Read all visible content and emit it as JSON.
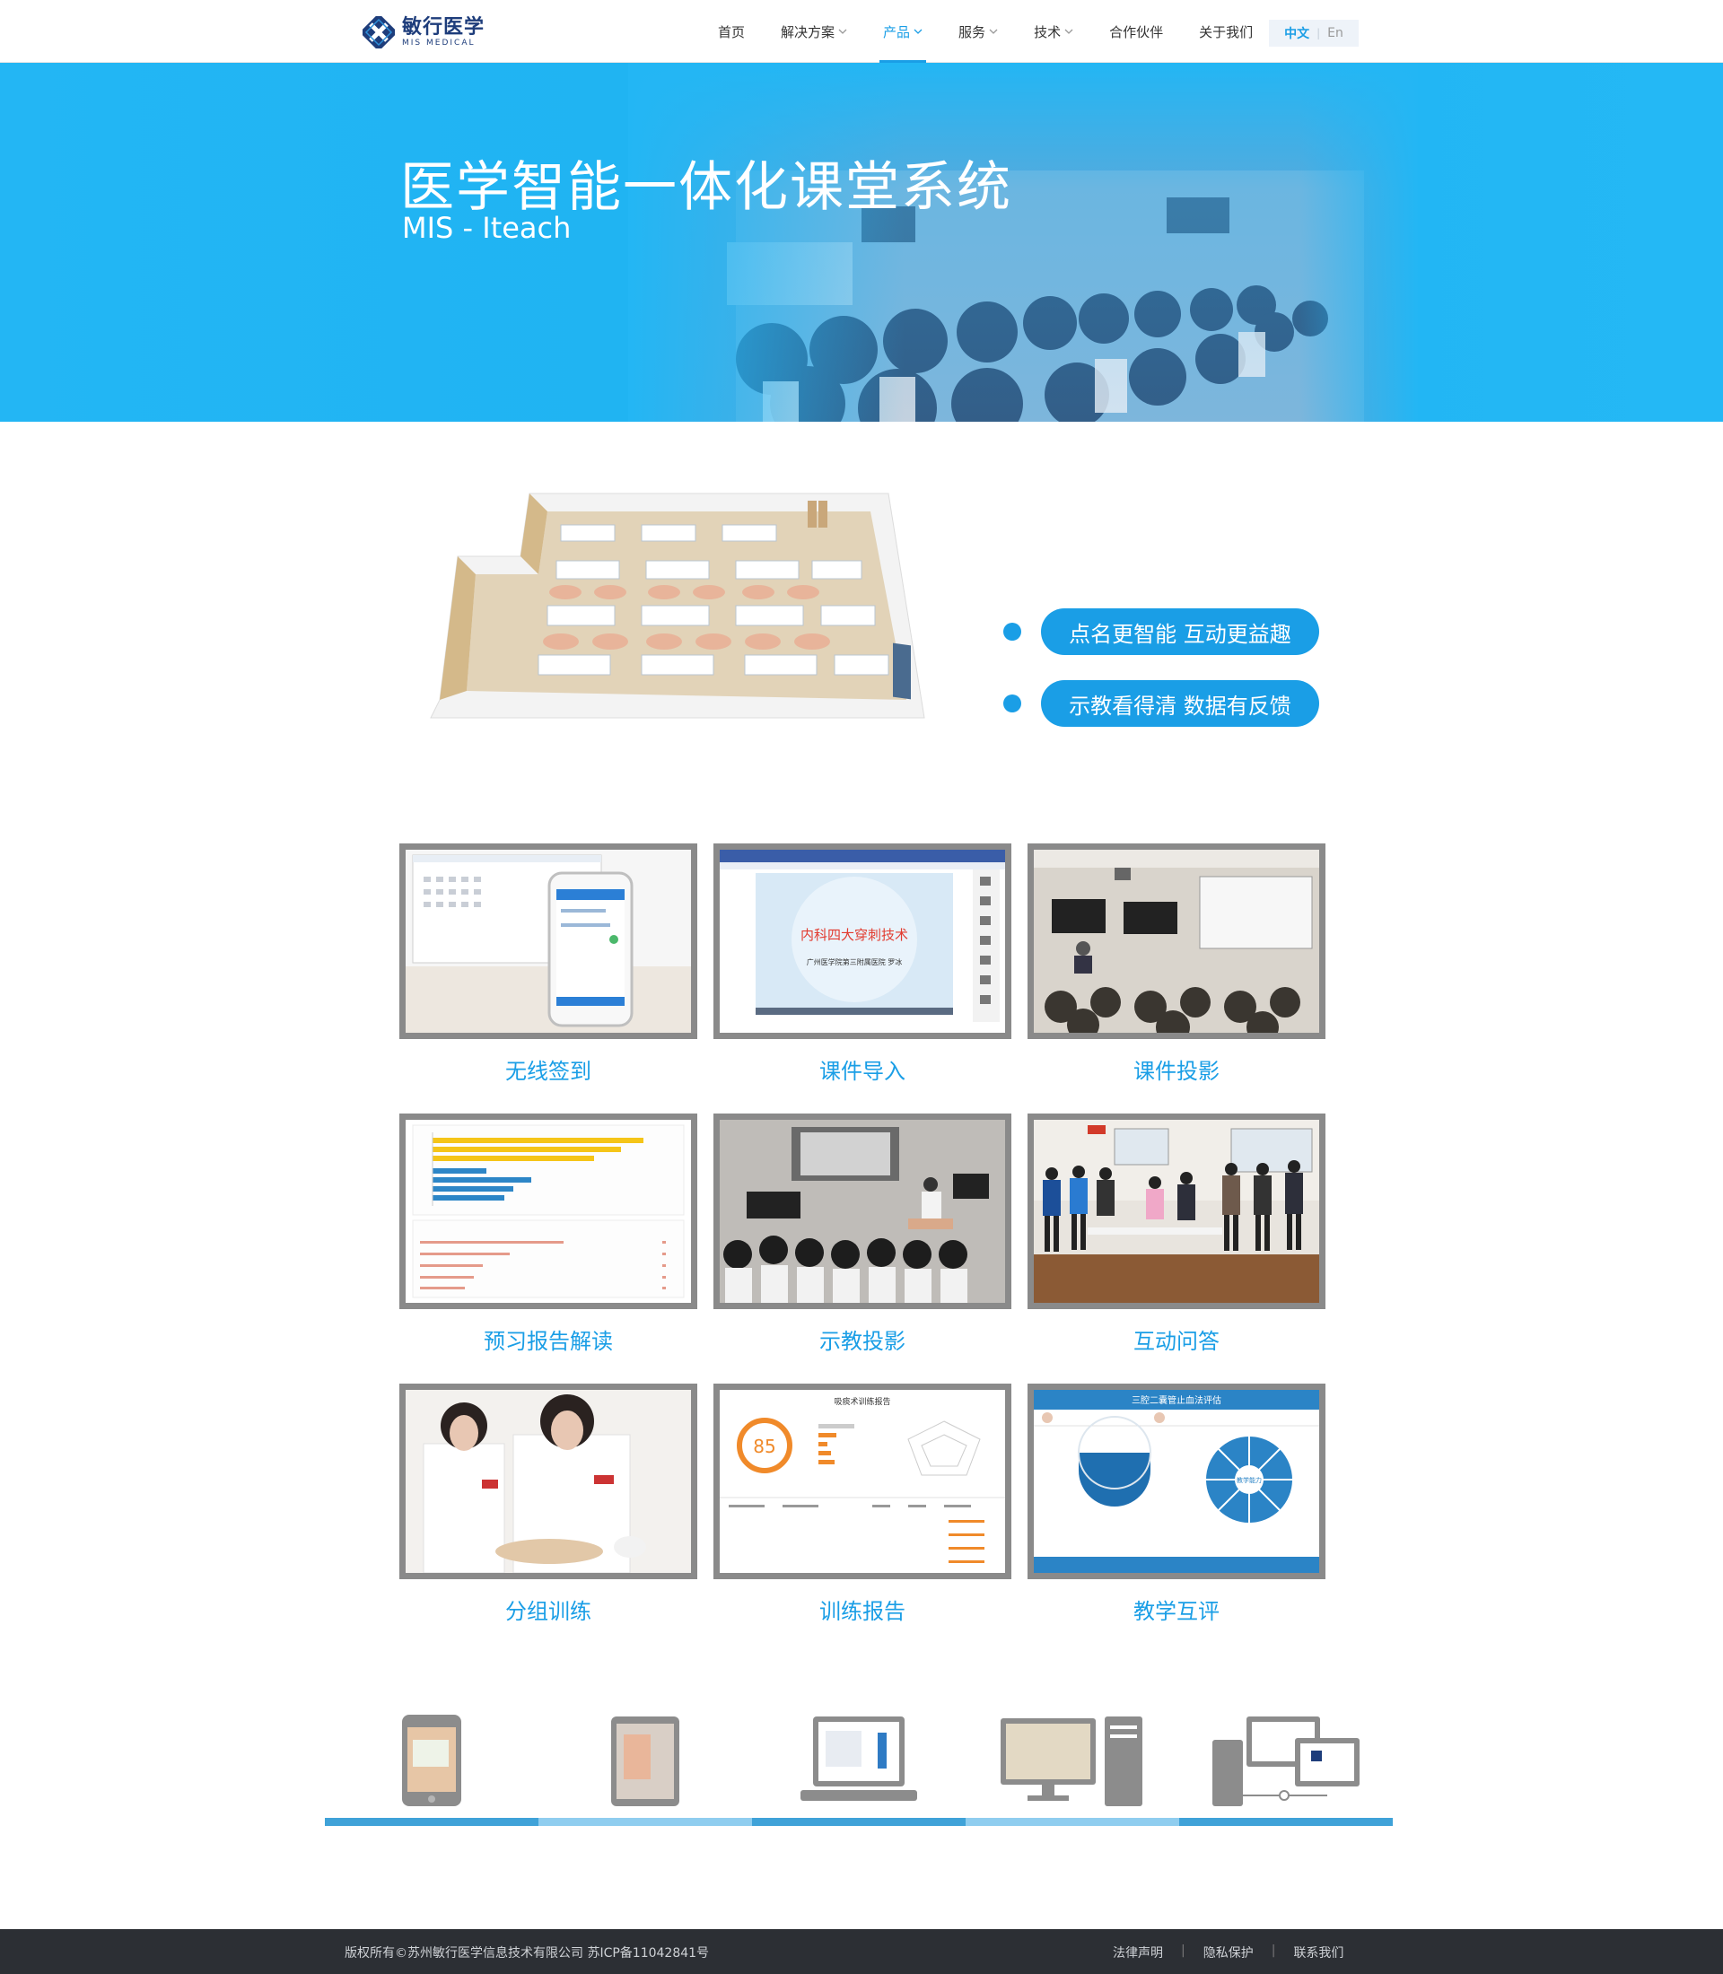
{
  "header": {
    "logo_cn": "敏行医学",
    "logo_en": "MIS MEDICAL",
    "nav": [
      {
        "label": "首页",
        "dropdown": false,
        "active": false
      },
      {
        "label": "解决方案",
        "dropdown": true,
        "active": false
      },
      {
        "label": "产品",
        "dropdown": true,
        "active": true
      },
      {
        "label": "服务",
        "dropdown": true,
        "active": false
      },
      {
        "label": "技术",
        "dropdown": true,
        "active": false
      },
      {
        "label": "合作伙伴",
        "dropdown": false,
        "active": false
      },
      {
        "label": "关于我们",
        "dropdown": false,
        "active": false
      }
    ],
    "lang_cn": "中文",
    "lang_sep": "|",
    "lang_en": "En"
  },
  "banner": {
    "title": "医学智能一体化课堂系统",
    "subtitle": "MIS - Iteach"
  },
  "features": [
    "点名更智能  互动更益趣",
    "示教看得清  数据有反馈"
  ],
  "grid": [
    {
      "caption": "无线签到"
    },
    {
      "caption": "课件导入",
      "slide_title": "内科四大穿刺技术",
      "slide_sub": "广州医学院第三附属医院    罗冰"
    },
    {
      "caption": "课件投影"
    },
    {
      "caption": "预习报告解读"
    },
    {
      "caption": "示教投影"
    },
    {
      "caption": "互动问答"
    },
    {
      "caption": "分组训练"
    },
    {
      "caption": "训练报告",
      "report_title": "吸痰术训练报告",
      "score": "85"
    },
    {
      "caption": "教学互评",
      "eval_title": "三腔二囊管止血法评估",
      "eval_center": "教学能力"
    }
  ],
  "colors": {
    "accent": "#1a9ee6",
    "banner": "#23b6f4",
    "thumb_border": "#8a8a8a",
    "footer": "#2c2f34",
    "bar_dark": "#3fa2d8",
    "bar_light": "#8fcdef"
  },
  "devices": [
    "phone-icon",
    "tablet-icon",
    "laptop-icon",
    "desktop-icon",
    "workstation-icon"
  ],
  "footer": {
    "copyright": "版权所有©苏州敏行医学信息技术有限公司  苏ICP备11042841号",
    "links": [
      "法律声明",
      "隐私保护",
      "联系我们"
    ]
  }
}
